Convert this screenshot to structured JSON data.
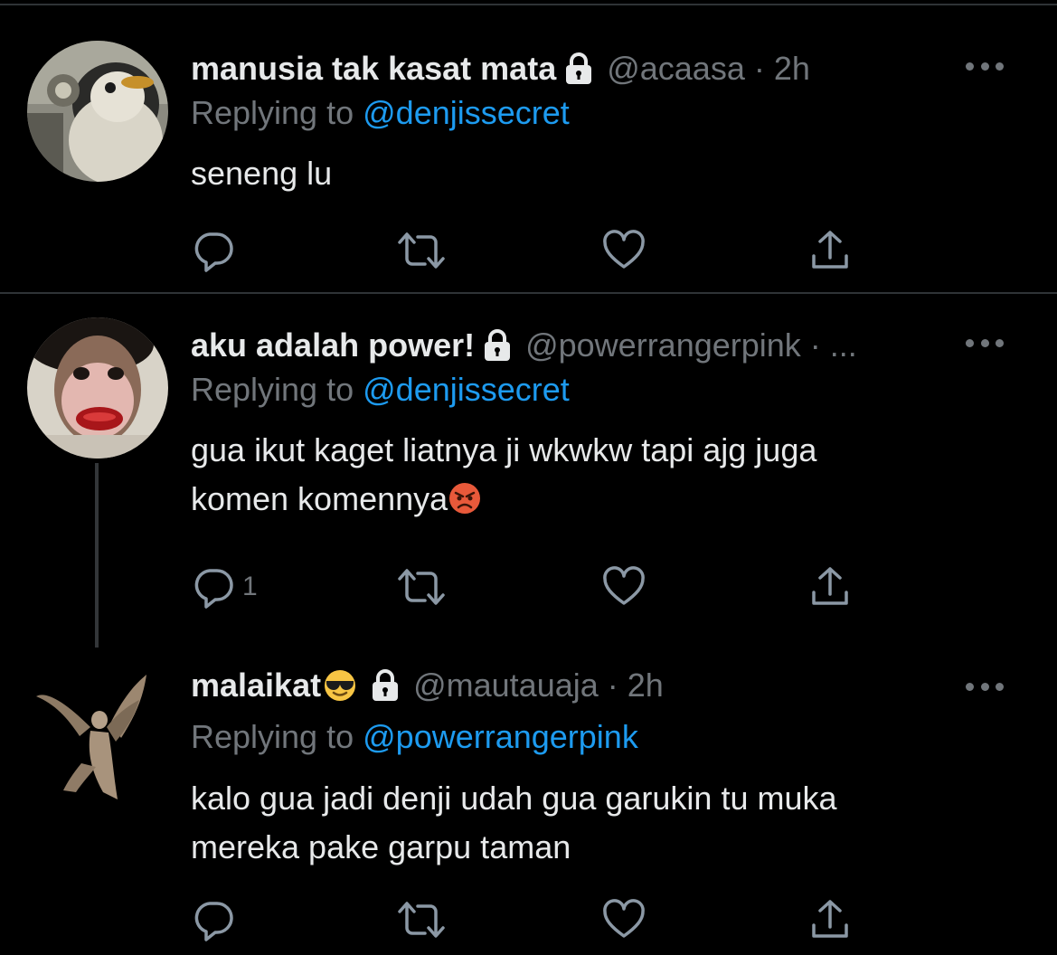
{
  "tweets": [
    {
      "name": "manusia tak kasat mata",
      "handle": "@acaasa",
      "separator": "·",
      "time": "2h",
      "replying_prefix": "Replying to",
      "replying_to": "@denjissecret",
      "text_lines": [
        "seneng lu"
      ],
      "reply_count": "",
      "avatar": "penguin-avatar"
    },
    {
      "name": "aku adalah power!",
      "handle": "@powerrangerpink",
      "separator": "·",
      "time": "...",
      "replying_prefix": "Replying to",
      "replying_to": "@denjissecret",
      "text_lines": [
        "gua ikut kaget liatnya ji wkwkw tapi ajg juga",
        "komen komennya"
      ],
      "reply_count": "1",
      "avatar": "pink-face-avatar"
    },
    {
      "name": "malaikat",
      "handle": "@mautauaja",
      "separator": "·",
      "time": "2h",
      "replying_prefix": "Replying to",
      "replying_to": "@powerrangerpink",
      "text_lines": [
        "kalo gua jadi denji udah gua garukin tu muka",
        "mereka pake garpu taman"
      ],
      "reply_count": "",
      "avatar": "angel-statue-avatar"
    }
  ],
  "icons": [
    "reply-icon",
    "retweet-icon",
    "like-icon",
    "share-icon",
    "lock-icon",
    "more-icon",
    "angry-face-emoji",
    "sunglasses-emoji"
  ],
  "colors": {
    "background": "#000000",
    "text": "#E7E9EA",
    "secondary": "#71767B",
    "mention": "#1D9BF0",
    "divider": "#2F3336"
  }
}
